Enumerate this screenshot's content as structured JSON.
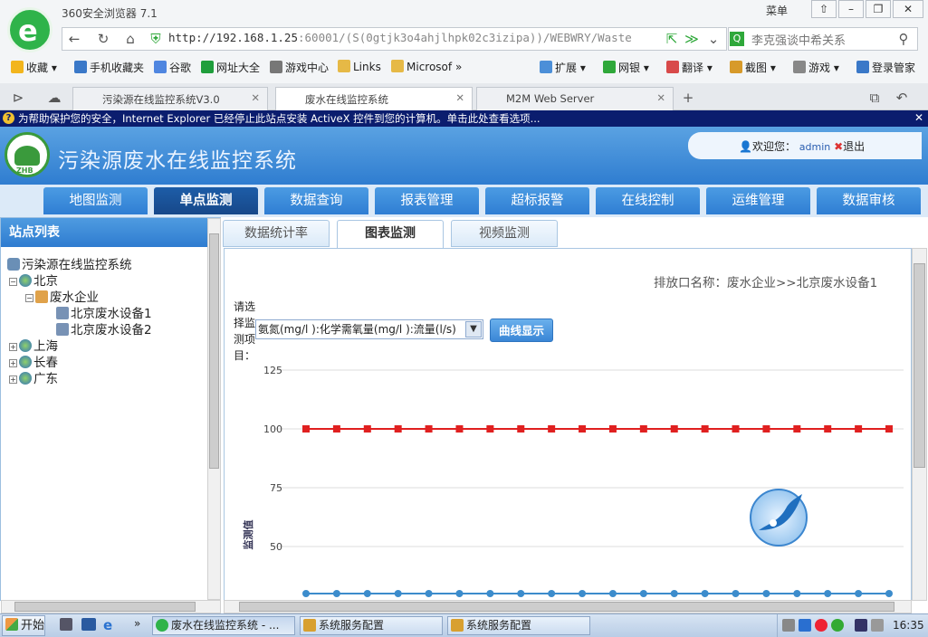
{
  "browser": {
    "title": "360安全浏览器 7.1",
    "menu": "菜单",
    "address_host": "http://192.168.1.25",
    "address_rest": ":60001/(S(0gtjk3o4ahjlhpk02c3izipa))/WEBWRY/Waste",
    "search_text": "李克强谈中希关系",
    "bookmarks": [
      "收藏",
      "手机收藏夹",
      "谷歌",
      "网址大全",
      "游戏中心",
      "Links",
      "Microsof",
      "扩展",
      "网银",
      "翻译",
      "截图",
      "游戏",
      "登录管家"
    ],
    "tabs": [
      {
        "label": "污染源在线监控系统V3.0",
        "active": false
      },
      {
        "label": "废水在线监控系统",
        "active": true
      },
      {
        "label": "M2M Web Server",
        "active": false
      }
    ],
    "infobar": "为帮助保护您的安全，Internet Explorer 已经停止此站点安装 ActiveX 控件到您的计算机。单击此处查看选项..."
  },
  "app": {
    "title": "污染源废水在线监控系统",
    "logo_text": "ZHB",
    "welcome": "欢迎您：",
    "user": "admin",
    "logout": "退出",
    "nav": [
      "地图监测",
      "单点监测",
      "数据查询",
      "报表管理",
      "超标报警",
      "在线控制",
      "运维管理",
      "数据审核"
    ],
    "nav_active": 1,
    "sidebar": {
      "title": "站点列表",
      "root": "污染源在线监控系统",
      "nodes": {
        "beijing": "北京",
        "enterprise": "废水企业",
        "device1": "北京废水设备1",
        "device2": "北京废水设备2",
        "shanghai": "上海",
        "changchun": "长春",
        "guangdong": "广东"
      }
    },
    "content_tabs": [
      "数据统计率",
      "图表监测",
      "视频监测"
    ],
    "content_tab_active": 1,
    "outfall_label": "排放口名称：",
    "outfall_value": "废水企业>>北京废水设备1",
    "select_label": "请选择监测项目：",
    "select_value": "氨氮(mg/l ):化学需氧量(mg/l ):流量(l/s)",
    "curve_button": "曲线显示"
  },
  "chart_data": {
    "type": "line",
    "ylabel": "监测值",
    "yticks": [
      125,
      100,
      75,
      50
    ],
    "ylim": [
      25,
      125
    ],
    "series": [
      {
        "color": "#e02020",
        "values": [
          100,
          100,
          100,
          100,
          100,
          100,
          100,
          100,
          100,
          100,
          100,
          100,
          100,
          100,
          100,
          100,
          100,
          100,
          100,
          100
        ]
      },
      {
        "color": "#3c8ccc",
        "values": [
          30,
          30,
          30,
          30,
          30,
          30,
          30,
          30,
          30,
          30,
          30,
          30,
          30,
          30,
          30,
          30,
          30,
          30,
          30,
          30
        ]
      }
    ]
  },
  "taskbar": {
    "start": "开始",
    "items": [
      "废水在线监控系统 - ...",
      "系统服务配置",
      "系统服务配置"
    ],
    "clock": "16:35"
  }
}
